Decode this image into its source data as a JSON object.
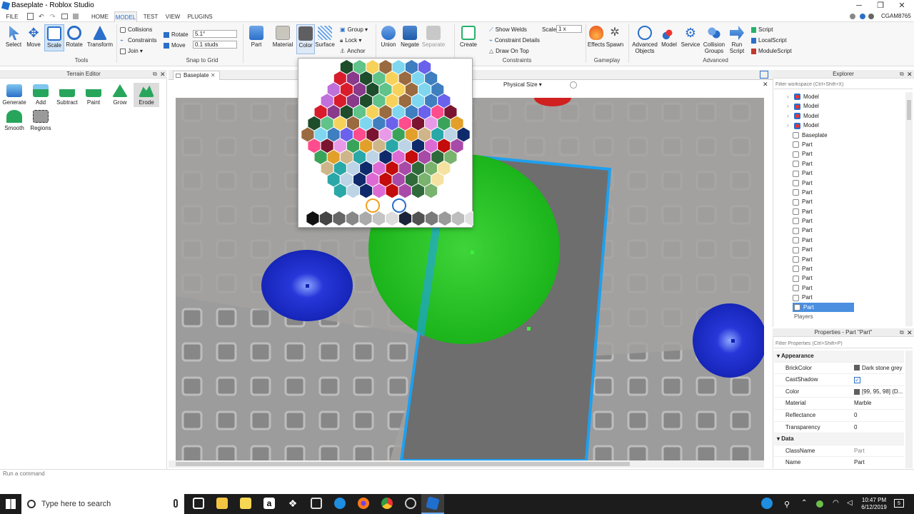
{
  "window": {
    "title": "Baseplate - Roblox Studio",
    "user": "CGAM8765"
  },
  "menu": {
    "file": "FILE",
    "tabs": [
      "HOME",
      "MODEL",
      "TEST",
      "VIEW",
      "PLUGINS"
    ],
    "active_tab": "MODEL"
  },
  "ribbon": {
    "tools": {
      "select": "Select",
      "move": "Move",
      "scale": "Scale",
      "rotate": "Rotate",
      "transform": "Transform",
      "group_label": "Tools"
    },
    "snap": {
      "collisions": "Collisions",
      "constraints": "Constraints",
      "join": "Join",
      "rotate_label": "Rotate",
      "rotate_value": "5.1°",
      "move_label": "Move",
      "move_value": "0.1 studs",
      "group_label": "Snap to Grid"
    },
    "parts": {
      "part": "Part",
      "material": "Material",
      "color": "Color",
      "surface": "Surface",
      "group": "Group",
      "lock": "Lock",
      "anchor": "Anchor"
    },
    "solid": {
      "union": "Union",
      "negate": "Negate",
      "separate": "Separate"
    },
    "constraints": {
      "create": "Create",
      "show_welds": "Show Welds",
      "constraint_details": "Constraint Details",
      "draw_on_top": "Draw On Top",
      "scale_label": "Scale",
      "scale_value": "1 x",
      "group_label": "Constraints"
    },
    "gameplay": {
      "effects": "Effects",
      "spawn": "Spawn",
      "group_label": "Gameplay"
    },
    "advanced": {
      "advanced_objects_1": "Advanced",
      "advanced_objects_2": "Objects",
      "model": "Model",
      "service": "Service",
      "collision_1": "Collision",
      "collision_2": "Groups",
      "run_1": "Run",
      "run_2": "Script",
      "script": "Script",
      "local_script": "LocalScript",
      "module_script": "ModuleScript",
      "group_label": "Advanced"
    }
  },
  "terrain": {
    "title": "Terrain Editor",
    "tools": [
      "Generate",
      "Add",
      "Subtract",
      "Paint",
      "Grow",
      "Erode",
      "Smooth",
      "Regions"
    ]
  },
  "doc_tab": {
    "label": "Baseplate"
  },
  "viewport_bar": {
    "physical_size": "Physical Size"
  },
  "explorer": {
    "title": "Explorer",
    "filter_placeholder": "Filter workspace (Ctrl+Shift+X)",
    "items": [
      "Model",
      "Model",
      "Model",
      "Model",
      "Baseplate",
      "Part",
      "Part",
      "Part",
      "Part",
      "Part",
      "Part",
      "Part",
      "Part",
      "Part",
      "Part",
      "Part",
      "Part",
      "Part",
      "Part",
      "Part",
      "Part",
      "Part",
      "Part"
    ],
    "partial_item": "Players",
    "selected_index": 22
  },
  "properties": {
    "title": "Properties - Part \"Part\"",
    "filter_placeholder": "Filter Properties (Ctrl+Shift+P)",
    "section_appearance": "Appearance",
    "section_data": "Data",
    "rows": [
      {
        "name": "BrickColor",
        "value": "Dark stone grey"
      },
      {
        "name": "CastShadow",
        "value": ""
      },
      {
        "name": "Color",
        "value": "[99, 95, 98] (D..."
      },
      {
        "name": "Material",
        "value": "Marble"
      },
      {
        "name": "Reflectance",
        "value": "0"
      },
      {
        "name": "Transparency",
        "value": "0"
      }
    ],
    "data_rows": [
      {
        "name": "ClassName",
        "value": "Part"
      },
      {
        "name": "Name",
        "value": "Part"
      }
    ]
  },
  "command_bar": {
    "placeholder": "Run a command"
  },
  "taskbar": {
    "search_placeholder": "Type here to search",
    "time": "10:47 PM",
    "date": "6/12/2019",
    "notifications": "5"
  },
  "colors": {
    "accent": "#2a6fc9",
    "selection": "#4a8fe0",
    "viewport_edge": "#1ea0f0"
  }
}
